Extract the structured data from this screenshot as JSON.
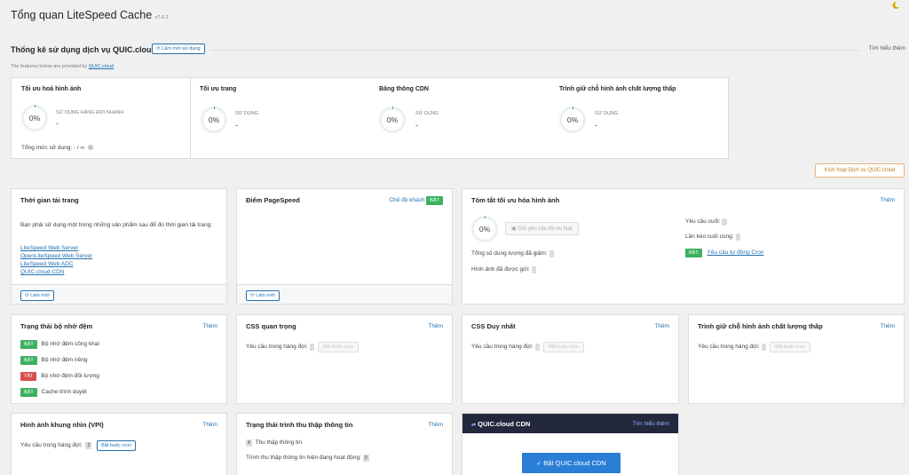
{
  "header": {
    "title": "Tổng quan LiteSpeed Cache",
    "version": "v7.6.2"
  },
  "usage": {
    "title": "Thống kê sử dụng dịch vụ QUIC.cloud",
    "refresh_label": "Làm mới sử dụng",
    "learn_more": "Tìm hiểu thêm",
    "features_text": "The features below are provided by",
    "features_link": "QUIC.cloud",
    "panels": [
      {
        "title": "Tối ưu hoá hình ảnh",
        "percent": "0%",
        "label": "SỬ DỤNG HÀNG ĐỢI NHANH",
        "value": "-"
      },
      {
        "title": "Tối ưu trang",
        "percent": "0%",
        "label": "SỬ DỤNG",
        "value": "-"
      },
      {
        "title": "Băng thông CDN",
        "percent": "0%",
        "label": "SỬ DỤNG",
        "value": "-"
      },
      {
        "title": "Trình giữ chỗ hình ảnh chất lượng thấp",
        "percent": "0%",
        "label": "SỬ DỤNG",
        "value": "-"
      }
    ],
    "total_usage": "Tổng mức sử dụng: - / ∞",
    "activate_button": "Kích hoạt Dịch vụ QUIC.cloud"
  },
  "load_time": {
    "title": "Thời gian tải trang",
    "message": "Bạn phải sử dụng một trong những sản phẩm sau để đo thời gian tải trang:",
    "links": [
      "LiteSpeed Web Server",
      "OpenLiteSpeed Web Server",
      "LiteSpeed Web ADC",
      "QUIC.cloud CDN"
    ],
    "refresh": "Làm mới"
  },
  "pagespeed": {
    "title": "Điểm PageSpeed",
    "guest_mode": "Chế độ khách",
    "status": "BẬT",
    "refresh": "Làm mới"
  },
  "img_summary": {
    "title": "Tóm tắt tối ưu hóa hình ảnh",
    "more": "Thêm",
    "percent": "0%",
    "send_request": "Gửi yêu cầu tối ưu hóa",
    "total_reduced": "Tổng số dung lượng đã giảm:",
    "images_sent": "Hình ảnh đã được gửi:",
    "last_request": "Yêu cầu cuối:",
    "last_pull": "Lần kéo cuối cùng:",
    "cron_status": "BẬT",
    "cron_link": "Yêu cầu tự động Cron"
  },
  "cache_status": {
    "title": "Trạng thái bộ nhớ đệm",
    "more": "Thêm",
    "items": [
      {
        "status": "BẬT",
        "label": "Bộ nhớ đệm công khai",
        "on": true
      },
      {
        "status": "BẬT",
        "label": "Bộ nhớ đệm riêng",
        "on": true
      },
      {
        "status": "TẮT",
        "label": "Bộ nhớ đệm đối tượng",
        "on": false
      },
      {
        "status": "BẬT",
        "label": "Cache trình duyệt",
        "on": true
      }
    ]
  },
  "ccss": {
    "title": "CSS quan trọng",
    "more": "Thêm",
    "queue": "Yêu cầu trong hàng đợi:",
    "btn": "Bắt buộc cron"
  },
  "ucss": {
    "title": "CSS Duy nhất",
    "more": "Thêm",
    "queue": "Yêu cầu trong hàng đợi:",
    "btn": "Bắt buộc cron"
  },
  "lqip": {
    "title": "Trình giữ chỗ hình ảnh chất lượng thấp",
    "more": "Thêm",
    "queue": "Yêu cầu trong hàng đợi:",
    "btn": "Bắt buộc cron"
  },
  "vpi": {
    "title": "Hình ảnh khung nhìn (VPI)",
    "more": "Thêm",
    "queue": "Yêu cầu trong hàng đợi:",
    "count": "2",
    "btn": "Bắt buộc cron"
  },
  "crawler": {
    "title": "Trạng thái trình thu thập thông tin",
    "more": "Thêm",
    "count": "4",
    "label": "Thu thập thông tin",
    "active": "Trình thu thập thông tin hiện đang hoạt động:",
    "active_count": "0"
  },
  "cdn": {
    "title": "QUIC.cloud CDN",
    "learn_more": "Tìm hiểu thêm",
    "button": "Bật QUIC.cloud CDN"
  },
  "colors": {
    "green": "#3cb15f",
    "red": "#d94e4e",
    "blue": "#2271b1",
    "navy": "#23283d"
  }
}
